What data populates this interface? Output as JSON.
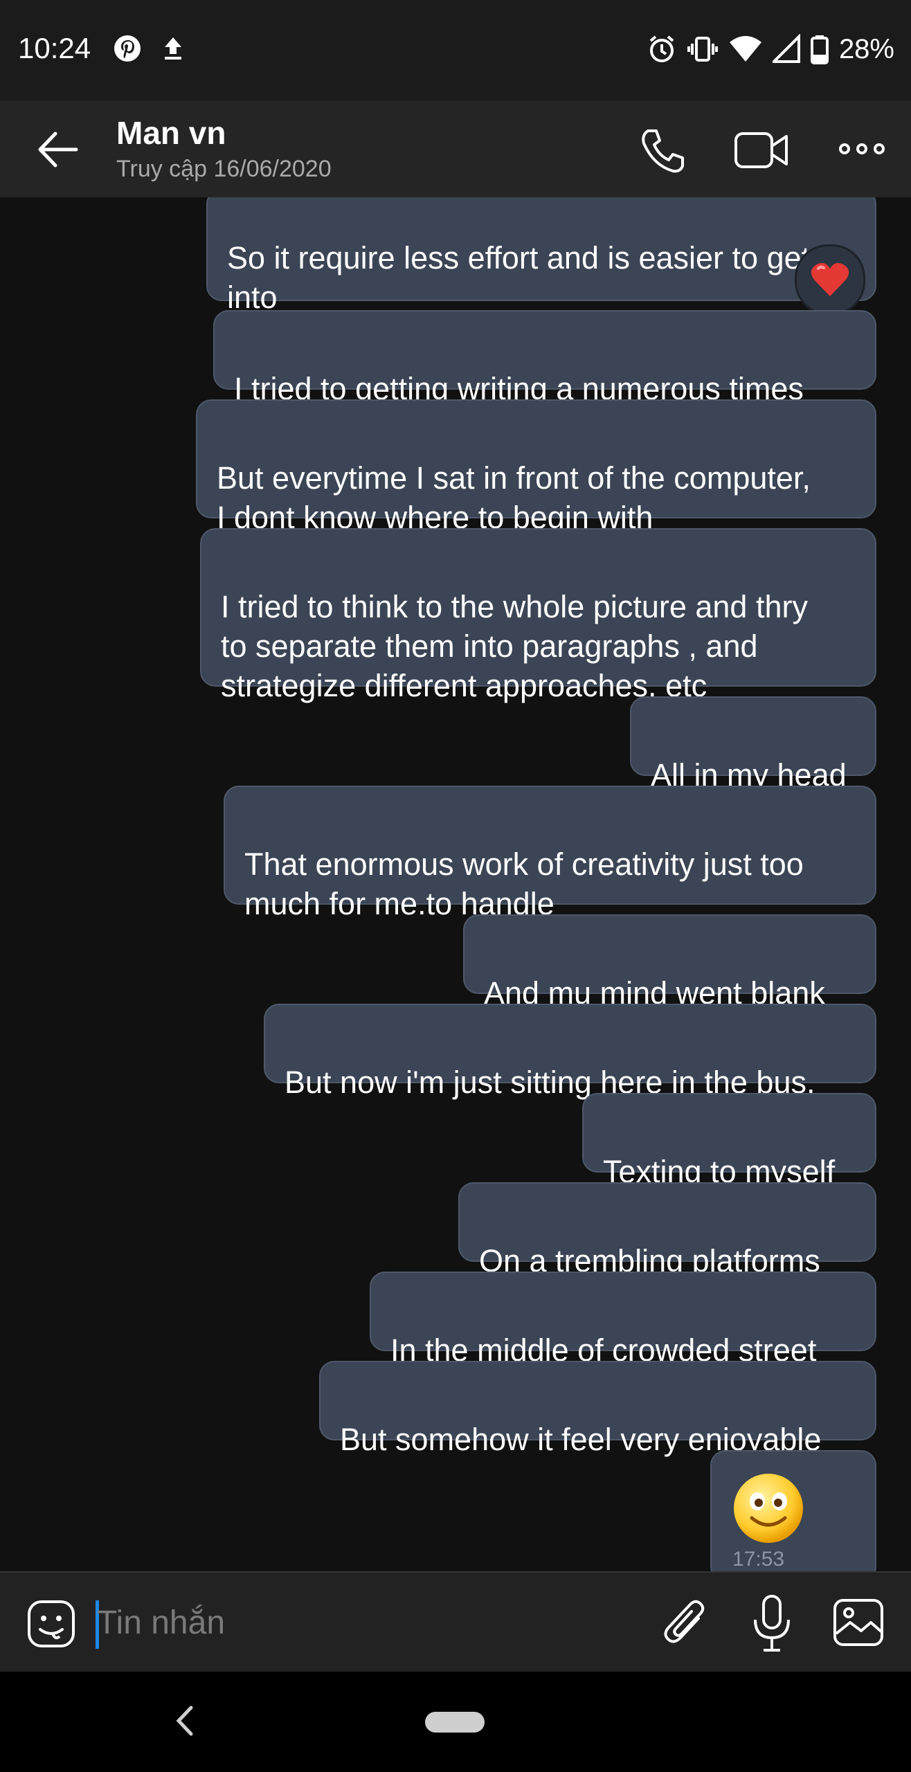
{
  "status_bar": {
    "time": "10:24",
    "battery_percent": "28%"
  },
  "header": {
    "contact_name": "Man vn",
    "last_seen": "Truy cập 16/06/2020"
  },
  "messages": [
    {
      "text": "So it require less effort and is easier to get\ninto",
      "reaction": "heart"
    },
    {
      "text": "I tried to getting writing a numerous times"
    },
    {
      "text": "But everytime I sat in front of the computer,\nI dont know where to begin with"
    },
    {
      "text": "I tried to think to the whole picture and thry\nto separate them into paragraphs , and\nstrategize different approaches, etc"
    },
    {
      "text": "All in my head"
    },
    {
      "text": "That enormous work of creativity just too\nmuch for me.to handle"
    },
    {
      "text": "And mu mind went blank"
    },
    {
      "text": "But now i'm just sitting here in the bus,"
    },
    {
      "text": "Texting to myself"
    },
    {
      "text": "On a trembling platforms"
    },
    {
      "text": "In the middle of crowded street"
    },
    {
      "text": "But somehow it feel very enjoyable"
    },
    {
      "emoji": "smiling-face-emoji",
      "time": "17:53"
    }
  ],
  "composer": {
    "placeholder": "Tin nhắn"
  },
  "colors": {
    "bubble_bg": "#3b4555",
    "background": "#111111",
    "header_bg": "#252525",
    "cursor": "#1e88e5"
  }
}
